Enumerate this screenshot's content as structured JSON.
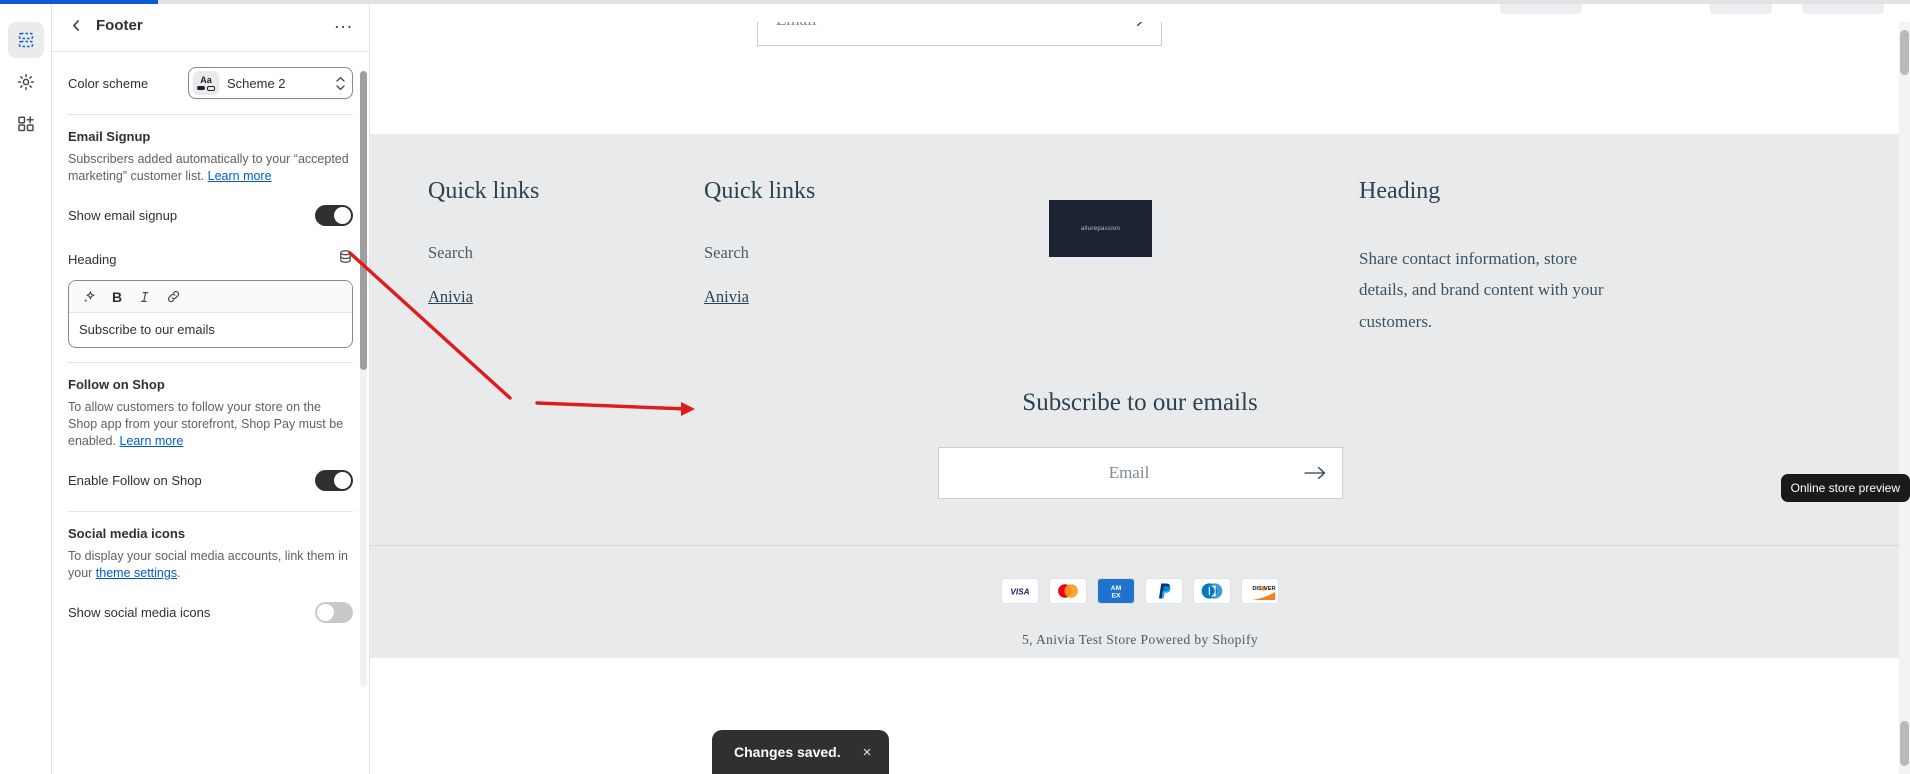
{
  "progress": {
    "percent": 8
  },
  "rail": {
    "items": [
      {
        "name": "sections-icon",
        "label": "Sections",
        "active": true
      },
      {
        "name": "gear-icon",
        "label": "Theme settings",
        "active": false
      },
      {
        "name": "apps-icon",
        "label": "Apps",
        "active": false
      }
    ]
  },
  "sidebar": {
    "back_label": "Back",
    "title": "Footer",
    "more_label": "...",
    "color_scheme": {
      "label": "Color scheme",
      "value": "Scheme 2",
      "swatch_text": "Aa"
    },
    "email_signup": {
      "title": "Email Signup",
      "description_before": "Subscribers added automatically to your “accepted marketing” customer list. ",
      "description_link": "Learn more",
      "toggle_label": "Show email signup",
      "toggle_on": true,
      "heading_label": "Heading",
      "heading_value": "Subscribe to our emails",
      "toolbar": [
        "sparkle-icon",
        "bold-icon",
        "italic-icon",
        "link-icon"
      ]
    },
    "follow_on_shop": {
      "title": "Follow on Shop",
      "description_before": "To allow customers to follow your store on the Shop app from your storefront, Shop Pay must be enabled. ",
      "description_link": "Learn more",
      "toggle_label": "Enable Follow on Shop",
      "toggle_on": true
    },
    "social_media": {
      "title": "Social media icons",
      "description_before": "To display your social media accounts, link them in your ",
      "description_link": "theme settings",
      "description_after": ".",
      "toggle_label": "Show social media icons",
      "toggle_on": false
    }
  },
  "preview": {
    "tooltip": "Online store preview",
    "top_email_placeholder": "Email",
    "columns": [
      {
        "heading": "Quick links",
        "links": [
          {
            "text": "Search",
            "underlined": false
          },
          {
            "text": "Anivia",
            "underlined": true
          }
        ]
      },
      {
        "heading": "Quick links",
        "links": [
          {
            "text": "Search",
            "underlined": false
          },
          {
            "text": "Anivia",
            "underlined": true
          }
        ]
      },
      {
        "brand_card_text": "allurepassion"
      },
      {
        "heading": "Heading",
        "body": "Share contact information, store details, and brand content with your customers."
      }
    ],
    "signup": {
      "heading": "Subscribe to our emails",
      "email_placeholder": "Email"
    },
    "payments": [
      "VISA",
      "Mastercard",
      "AMEX",
      "PayPal",
      "Diners Club",
      "DISCOVER"
    ],
    "copyright": "5, Anivia Test Store Powered by Shopify"
  },
  "toast": {
    "message": "Changes saved.",
    "close_label": "×"
  },
  "colors": {
    "accent": "#0a5ad6",
    "link": "#005bd3",
    "toggle_on": "#303030",
    "toggle_off": "#c9c9c9",
    "footer_bg": "#e9eaec",
    "serif_text": "#2b4250",
    "annotation": "#e01b1b"
  }
}
